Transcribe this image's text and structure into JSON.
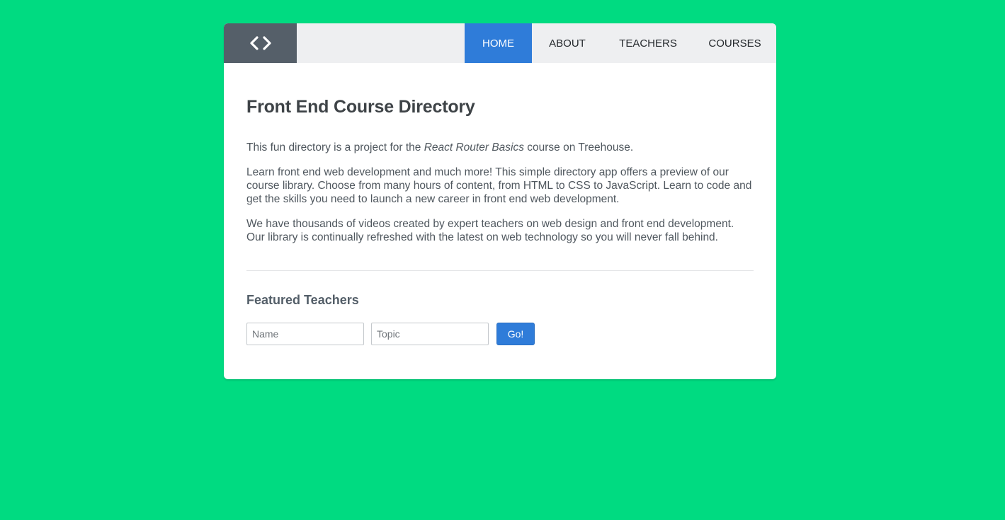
{
  "header": {
    "logo_icon": "code-brackets-icon",
    "nav": [
      {
        "label": "Home",
        "active": true
      },
      {
        "label": "About",
        "active": false
      },
      {
        "label": "Teachers",
        "active": false
      },
      {
        "label": "Courses",
        "active": false
      }
    ]
  },
  "main": {
    "title": "Front End Course Directory",
    "intro": {
      "before": "This fun directory is a project for the ",
      "emphasis": "React Router Basics",
      "after": " course on Treehouse."
    },
    "paragraph2": "Learn front end web development and much more! This simple directory app offers a preview of our course library. Choose from many hours of content, from HTML to CSS to JavaScript. Learn to code and get the skills you need to launch a new career in front end web development.",
    "paragraph3": "We have thousands of videos created by expert teachers on web design and front end development. Our library is continually refreshed with the latest on web technology so you will never fall behind."
  },
  "featured": {
    "heading": "Featured Teachers",
    "name_placeholder": "Name",
    "name_value": "",
    "topic_placeholder": "Topic",
    "topic_value": "",
    "button_label": "Go!"
  },
  "colors": {
    "background": "#00db81",
    "accent": "#2f7cd9",
    "logo_bg": "#555f69",
    "header_bg": "#eeeff1"
  }
}
